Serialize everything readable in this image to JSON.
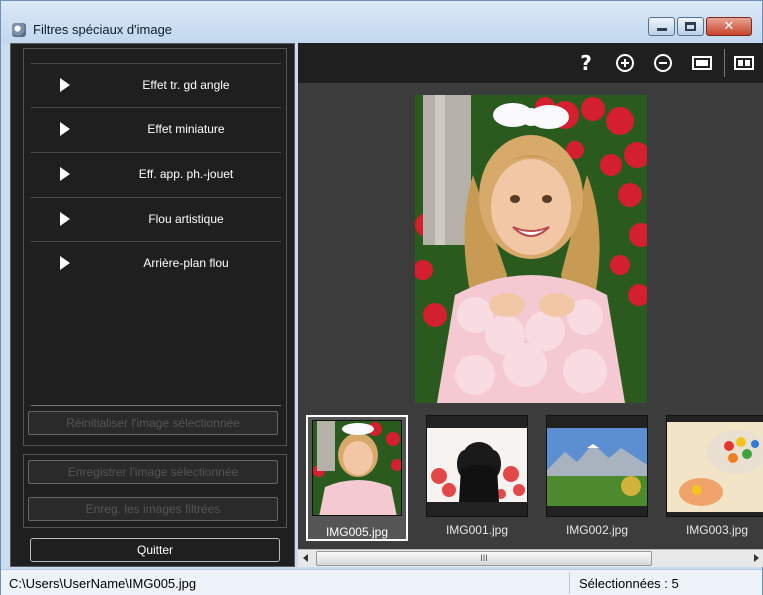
{
  "window": {
    "title": "Filtres spéciaux d'image",
    "buttons": [
      "minimize",
      "maximize",
      "close"
    ]
  },
  "filters": [
    {
      "label": "Effet tr. gd angle"
    },
    {
      "label": "Effet miniature"
    },
    {
      "label": "Eff. app. ph.-jouet"
    },
    {
      "label": "Flou artistique"
    },
    {
      "label": "Arrière-plan flou"
    }
  ],
  "actions": {
    "reset_label": "Réinitialiser l'image sélectionnée",
    "save_selected_label": "Enregistrer l'image sélectionnée",
    "save_filtered_label": "Enreg. les images filtrées",
    "quit_label": "Quitter"
  },
  "toolbar": {
    "help_icon": "question-mark-icon",
    "zoom_in_icon": "zoom-in-icon",
    "zoom_out_icon": "zoom-out-icon",
    "single_view_icon": "single-view-icon",
    "compare_view_icon": "compare-view-icon"
  },
  "thumbnails": [
    {
      "name": "IMG005.jpg",
      "selected": true
    },
    {
      "name": "IMG001.jpg",
      "selected": false
    },
    {
      "name": "IMG002.jpg",
      "selected": false
    },
    {
      "name": "IMG003.jpg",
      "selected": false
    }
  ],
  "scrollbar": {
    "grip": "III"
  },
  "status": {
    "path": "C:\\Users\\UserName\\IMG005.jpg",
    "selected": "Sélectionnées : 5"
  }
}
